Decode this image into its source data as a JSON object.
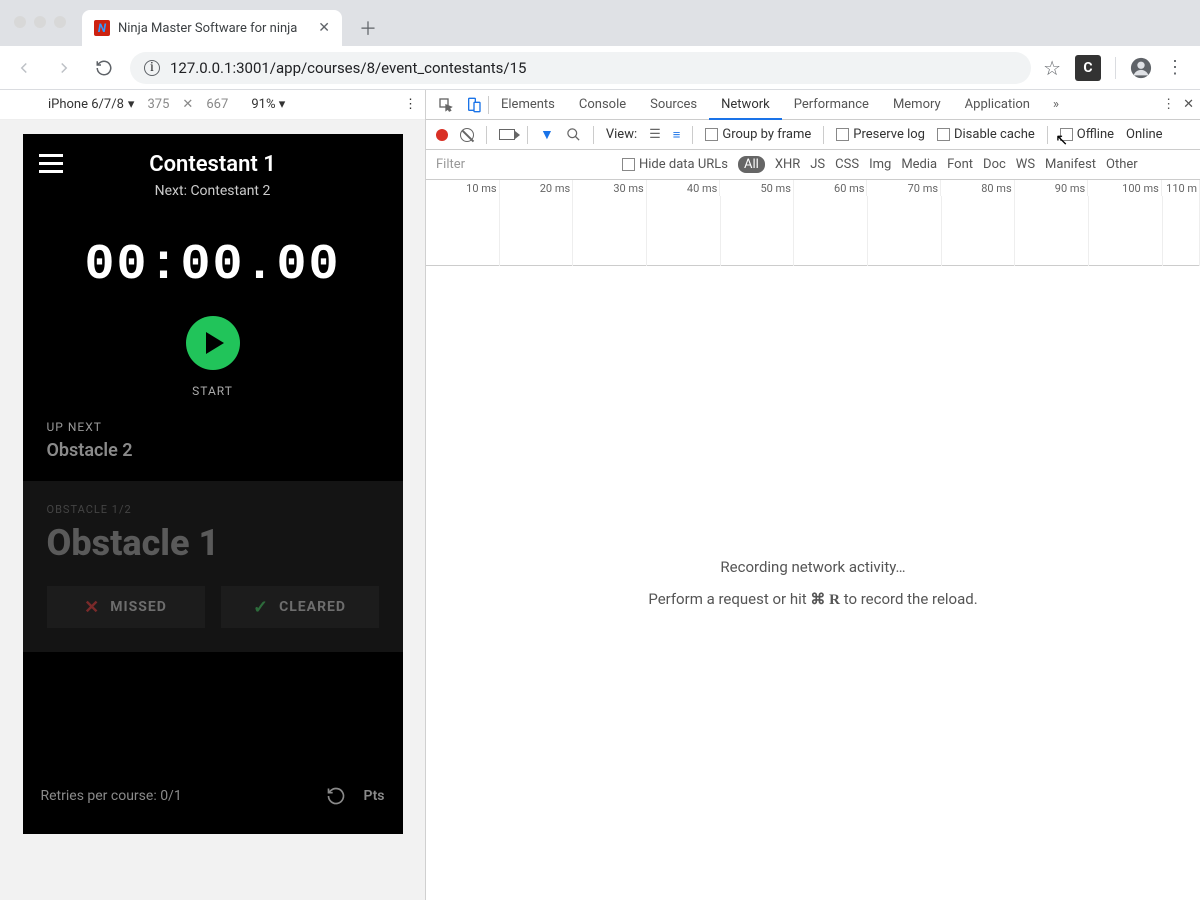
{
  "browser": {
    "tab_title": "Ninja Master Software for ninja",
    "favicon_letter": "N",
    "url": "127.0.0.1:3001/app/courses/8/event_contestants/15",
    "ext_badge": "C"
  },
  "device_bar": {
    "device": "iPhone 6/7/8",
    "width": "375",
    "height": "667",
    "zoom": "91%"
  },
  "phone": {
    "title": "Contestant 1",
    "next": "Next: Contestant 2",
    "timer": "00:00.00",
    "start_label": "START",
    "upnext_label": "UP NEXT",
    "upnext_value": "Obstacle 2",
    "obst_meta": "OBSTACLE 1/2",
    "obst_name": "Obstacle 1",
    "missed": "MISSED",
    "cleared": "CLEARED",
    "retries": "Retries per course: 0/1",
    "pts": "Pts"
  },
  "devtools": {
    "tabs": [
      "Elements",
      "Console",
      "Sources",
      "Network",
      "Performance",
      "Memory",
      "Application"
    ],
    "active_tab": "Network",
    "toolbar": {
      "view": "View:",
      "group": "Group by frame",
      "preserve": "Preserve log",
      "disable": "Disable cache",
      "offline": "Offline",
      "online": "Online"
    },
    "filter_placeholder": "Filter",
    "hide_urls": "Hide data URLs",
    "types": [
      "All",
      "XHR",
      "JS",
      "CSS",
      "Img",
      "Media",
      "Font",
      "Doc",
      "WS",
      "Manifest",
      "Other"
    ],
    "timeline_ticks": [
      "10 ms",
      "20 ms",
      "30 ms",
      "40 ms",
      "50 ms",
      "60 ms",
      "70 ms",
      "80 ms",
      "90 ms",
      "100 ms",
      "110 m"
    ],
    "recording": "Recording network activity…",
    "hint_pre": "Perform a request or hit ",
    "hint_key": "⌘ R",
    "hint_post": " to record the reload."
  }
}
